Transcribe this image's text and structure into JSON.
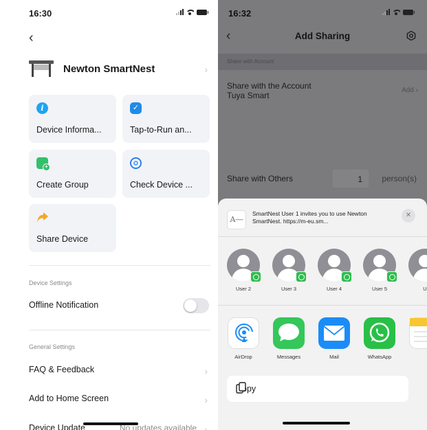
{
  "left": {
    "status_time": "16:30",
    "device_name": "Newton SmartNest",
    "cards": [
      {
        "label": "Device Informa...",
        "icon": "info-icon"
      },
      {
        "label": "Tap-to-Run an...",
        "icon": "tap-to-run-icon"
      },
      {
        "label": "Create Group",
        "icon": "create-group-icon"
      },
      {
        "label": "Check Device ...",
        "icon": "check-network-icon"
      },
      {
        "label": "Share Device",
        "icon": "share-arrow-icon"
      }
    ],
    "device_settings_title": "Device Settings",
    "offline_notification": {
      "label": "Offline Notification",
      "enabled": false
    },
    "general_settings_title": "General Settings",
    "faq": "FAQ & Feedback",
    "add_home": "Add to Home Screen",
    "device_update": {
      "label": "Device Update",
      "value": "No updates available"
    }
  },
  "right": {
    "status_time": "16:32",
    "title": "Add Sharing",
    "section_account": "Share with Account",
    "account_line1": "Share with the Account",
    "account_line2": "Tuya Smart",
    "account_add": "Add",
    "share_others": "Share with Others",
    "person_count": "1",
    "person_unit": "person(s)",
    "share_sheet": {
      "message": "SmartNest User 1 invites you to use Newton SmartNest. https://m-eu.sm...",
      "people": [
        "User 2",
        "User 3",
        "User 4",
        "User 5",
        "U"
      ],
      "apps": [
        "AirDrop",
        "Messages",
        "Mail",
        "WhatsApp"
      ],
      "copy_label": "Copy"
    }
  },
  "colors": {
    "card_bg": "#f2f3f7",
    "overlay": "#7b7b7e",
    "whatsapp": "#28c046",
    "mail": "#1a8cf8",
    "messages": "#34c759"
  }
}
